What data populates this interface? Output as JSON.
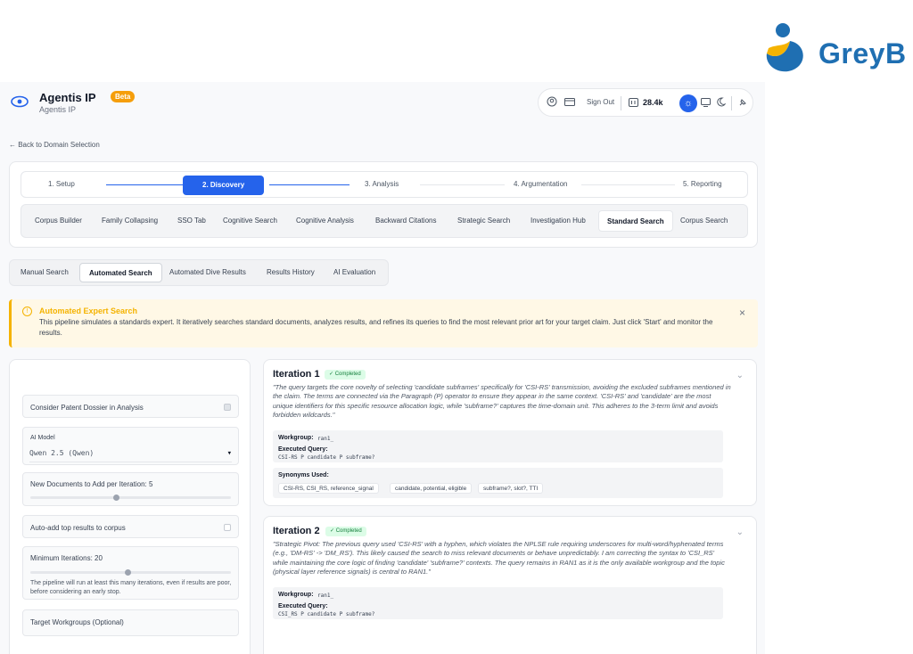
{
  "brand": {
    "name": "GreyB",
    "colors": {
      "primary": "#1f6fb2",
      "accent": "#f5b301"
    }
  },
  "app": {
    "title": "Agentis IP",
    "subtitle": "Agentis IP",
    "beta": "Beta",
    "sign_out": "Sign Out",
    "credits": "28.4k",
    "icons": [
      "user-icon",
      "card-icon",
      "credits-icon",
      "sun-icon",
      "monitor-icon",
      "moon-icon",
      "pin-icon"
    ]
  },
  "back_link": "← Back to Domain Selection",
  "steps": [
    "1. Setup",
    "2. Discovery",
    "3. Analysis",
    "4. Argumentation",
    "5. Reporting"
  ],
  "active_step": "2. Discovery",
  "phase_tabs": [
    "Corpus Builder",
    "Family Collapsing",
    "SSO Tab",
    "Cognitive Search",
    "Cognitive Analysis",
    "Backward Citations",
    "Strategic Search",
    "Investigation Hub",
    "Standard Search",
    "Corpus Search"
  ],
  "active_phase_tab": "Standard Search",
  "mode_tabs": [
    "Manual Search",
    "Automated Search",
    "Automated Dive Results",
    "Results History",
    "AI Evaluation"
  ],
  "active_mode_tab": "Automated Search",
  "alert": {
    "title": "Automated Expert Search",
    "body": "This pipeline simulates a standards expert. It iteratively searches standard documents, analyzes results, and refines its queries to find the most relevant prior art for your target claim. Just click 'Start' and monitor the results.",
    "close": "×"
  },
  "settings": {
    "dossier": {
      "label": "Consider Patent Dossier in Analysis",
      "checked": true
    },
    "ai_model": {
      "label": "AI Model",
      "value": "Qwen 2.5 (Qwen)"
    },
    "new_docs": {
      "label": "New Documents to Add per Iteration: 5"
    },
    "auto_add": {
      "label": "Auto-add top results to corpus",
      "checked": false
    },
    "min_iter": {
      "label": "Minimum Iterations: 20",
      "hint": "The pipeline will run at least this many iterations, even if results are poor, before considering an early stop."
    },
    "workgroups": {
      "label": "Target Workgroups (Optional)"
    }
  },
  "iterations": [
    {
      "title": "Iteration 1",
      "status": "✓ Completed",
      "quote": "\"The query targets the core novelty of selecting 'candidate subframes' specifically for 'CSI-RS' transmission, avoiding the excluded subframes mentioned in the claim. The terms are connected via the Paragraph (P) operator to ensure they appear in the same context. 'CSI-RS' and 'candidate' are the most unique identifiers for this specific resource allocation logic, while 'subframe?' captures the time-domain unit. This adheres to the 3-term limit and avoids forbidden wildcards.\"",
      "workgroup_label": "Workgroup:",
      "workgroup": "ran1_",
      "query_label": "Executed Query:",
      "query": "CSI-RS P candidate P subframe?",
      "synonyms_label": "Synonyms Used:",
      "synonyms": [
        "CSI-RS, CSI_RS, reference_signal",
        "candidate, potential, eligible",
        "subframe?, slot?, TTI"
      ]
    },
    {
      "title": "Iteration 2",
      "status": "✓ Completed",
      "quote": "\"Strategic Pivot: The previous query used 'CSI-RS' with a hyphen, which violates the NPLSE rule requiring underscores for multi-word/hyphenated terms (e.g., 'DM-RS' -> 'DM_RS'). This likely caused the search to miss relevant documents or behave unpredictably. I am correcting the syntax to 'CSI_RS' while maintaining the core logic of finding 'candidate' 'subframe?' contexts. The query remains in RAN1 as it is the only available workgroup and the topic (physical layer reference signals) is central to RAN1.\"",
      "workgroup_label": "Workgroup:",
      "workgroup": "ran1_",
      "query_label": "Executed Query:",
      "query": "CSI_RS P candidate P subframe?"
    }
  ]
}
